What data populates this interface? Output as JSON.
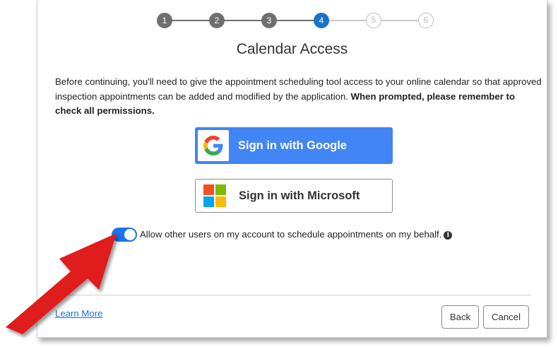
{
  "stepper": {
    "steps": [
      "1",
      "2",
      "3",
      "4",
      "5",
      "6"
    ],
    "current_step": 4
  },
  "title": "Calendar Access",
  "description": {
    "text": "Before continuing, you'll need to give the appointment scheduling tool access to your online calendar so that approved inspection appointments can be added and modified by the application.",
    "bold_text": "When prompted, please remember to check all permissions."
  },
  "auth_buttons": {
    "google_label": "Sign in with Google",
    "microsoft_label": "Sign in with Microsoft"
  },
  "delegation_toggle": {
    "label": "Allow other users on my account to schedule appointments on my behalf.",
    "checked": true,
    "info_icon": "i"
  },
  "footer": {
    "learn_more": "Learn More",
    "back_label": "Back",
    "cancel_label": "Cancel"
  },
  "colors": {
    "active_step": "#1a73c9",
    "google_button": "#4285f4",
    "toggle_on": "#1a73e8",
    "annotation_arrow": "#e01e1e"
  }
}
